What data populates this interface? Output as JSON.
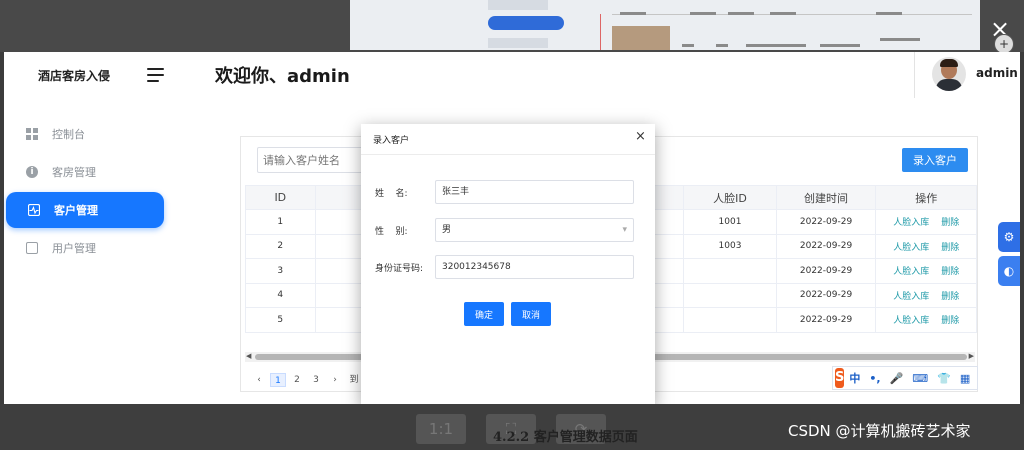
{
  "header": {
    "brand": "酒店客房入侵",
    "welcome": "欢迎你、admin",
    "username": "admin"
  },
  "sidebar": {
    "items": [
      {
        "label": "控制台",
        "icon": "dashboard-icon",
        "active": false
      },
      {
        "label": "客房管理",
        "icon": "info-icon",
        "active": false
      },
      {
        "label": "客户管理",
        "icon": "pulse-icon",
        "active": true
      },
      {
        "label": "用户管理",
        "icon": "copy-icon",
        "active": false
      }
    ]
  },
  "toolbar": {
    "search_placeholder": "请输入客户姓名",
    "add_label": "录入客户"
  },
  "table": {
    "headers": [
      "ID",
      "",
      "",
      "人脸ID",
      "创建时间",
      "操作"
    ],
    "rows": [
      {
        "id": "1",
        "face_id": "1001",
        "created": "2022-09-29"
      },
      {
        "id": "2",
        "face_id": "1003",
        "created": "2022-09-29"
      },
      {
        "id": "3",
        "face_id": "",
        "created": "2022-09-29"
      },
      {
        "id": "4",
        "face_id": "",
        "created": "2022-09-29"
      },
      {
        "id": "5",
        "face_id": "",
        "created": "2022-09-29"
      }
    ],
    "actions": [
      "人脸入库",
      "删除"
    ]
  },
  "pager": {
    "prev": "‹",
    "pages": [
      "1",
      "2",
      "3"
    ],
    "next": "›",
    "goto_text": "到"
  },
  "ime": {
    "logo": "S",
    "lang": "中",
    "punct": "•,"
  },
  "modal": {
    "title": "录入客户",
    "close": "×",
    "fields": [
      {
        "label": "姓    名:",
        "value": "张三丰"
      },
      {
        "label": "性    别:",
        "value": "男"
      },
      {
        "label": "身份证号码:",
        "value": "320012345678"
      }
    ],
    "ok_label": "确定",
    "cancel_label": "取消"
  },
  "viewer": {
    "btn_actual": "1:1",
    "caption": "4.2.2 客户管理数据页面",
    "watermark": "CSDN @计算机搬砖艺术家",
    "close": "×",
    "zoom": "+"
  },
  "colors": {
    "accent": "#1677ff",
    "link": "#1f9aa8",
    "ime_logo": "#ef5b1d"
  }
}
